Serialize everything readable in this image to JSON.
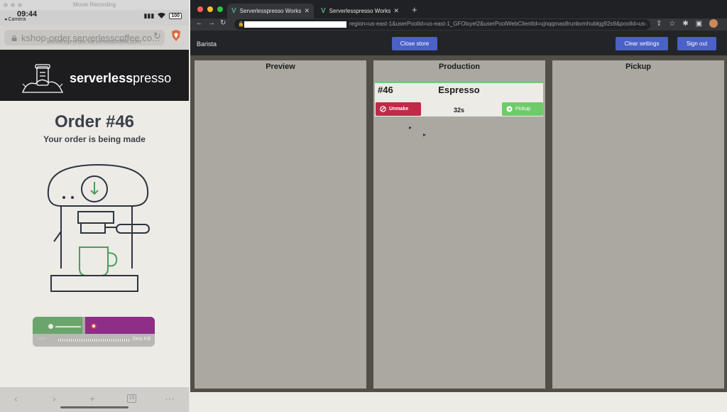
{
  "phone": {
    "window_title": "Movie Recording",
    "status_time": "09:44",
    "back_label": "◂ Camera",
    "battery": "100",
    "url_main": "kshop-order.serverlesscoffee.co...",
    "url_sub": "workshop-order.serverlesscoffee.com",
    "brand_prefix": "serverless",
    "brand_suffix": "presso",
    "order_title": "Order #46",
    "order_subtitle": "Your order is being made",
    "recorder": {
      "time": "--:--",
      "size": "Zero KB"
    },
    "tabs_count": "15"
  },
  "browser": {
    "tabs": [
      {
        "label": "Serverlesspresso Workshop - ",
        "active": true
      },
      {
        "label": "Serverlesspresso Workshop - ",
        "active": false
      }
    ],
    "url_tail": "region=us-east-1&userPoolId=us-east-1_GFOlxyel2&userPoolWebClientId=ujnqqmas8runbvmhubkjg92s9&poolId=us-...",
    "colors": {
      "close": "#ff5f57",
      "minimize": "#febc2e",
      "maximize": "#28c840"
    }
  },
  "app": {
    "role_label": "Barista",
    "close_store": "Close store",
    "clear_settings": "Clear settings",
    "sign_out": "Sign out",
    "columns": {
      "preview": "Preview",
      "production": "Production",
      "pickup": "Pickup"
    },
    "order_card": {
      "number": "#46",
      "drink": "Espresso",
      "timer": "32s",
      "unmake": "Unmake",
      "pickup": "Pickup"
    },
    "colors": {
      "accent_button": "#4a61c6",
      "unmake": "#c02a47",
      "pickup": "#6fcb6a",
      "column_bg": "#aaa8a0",
      "board_bg": "#514f46"
    }
  }
}
